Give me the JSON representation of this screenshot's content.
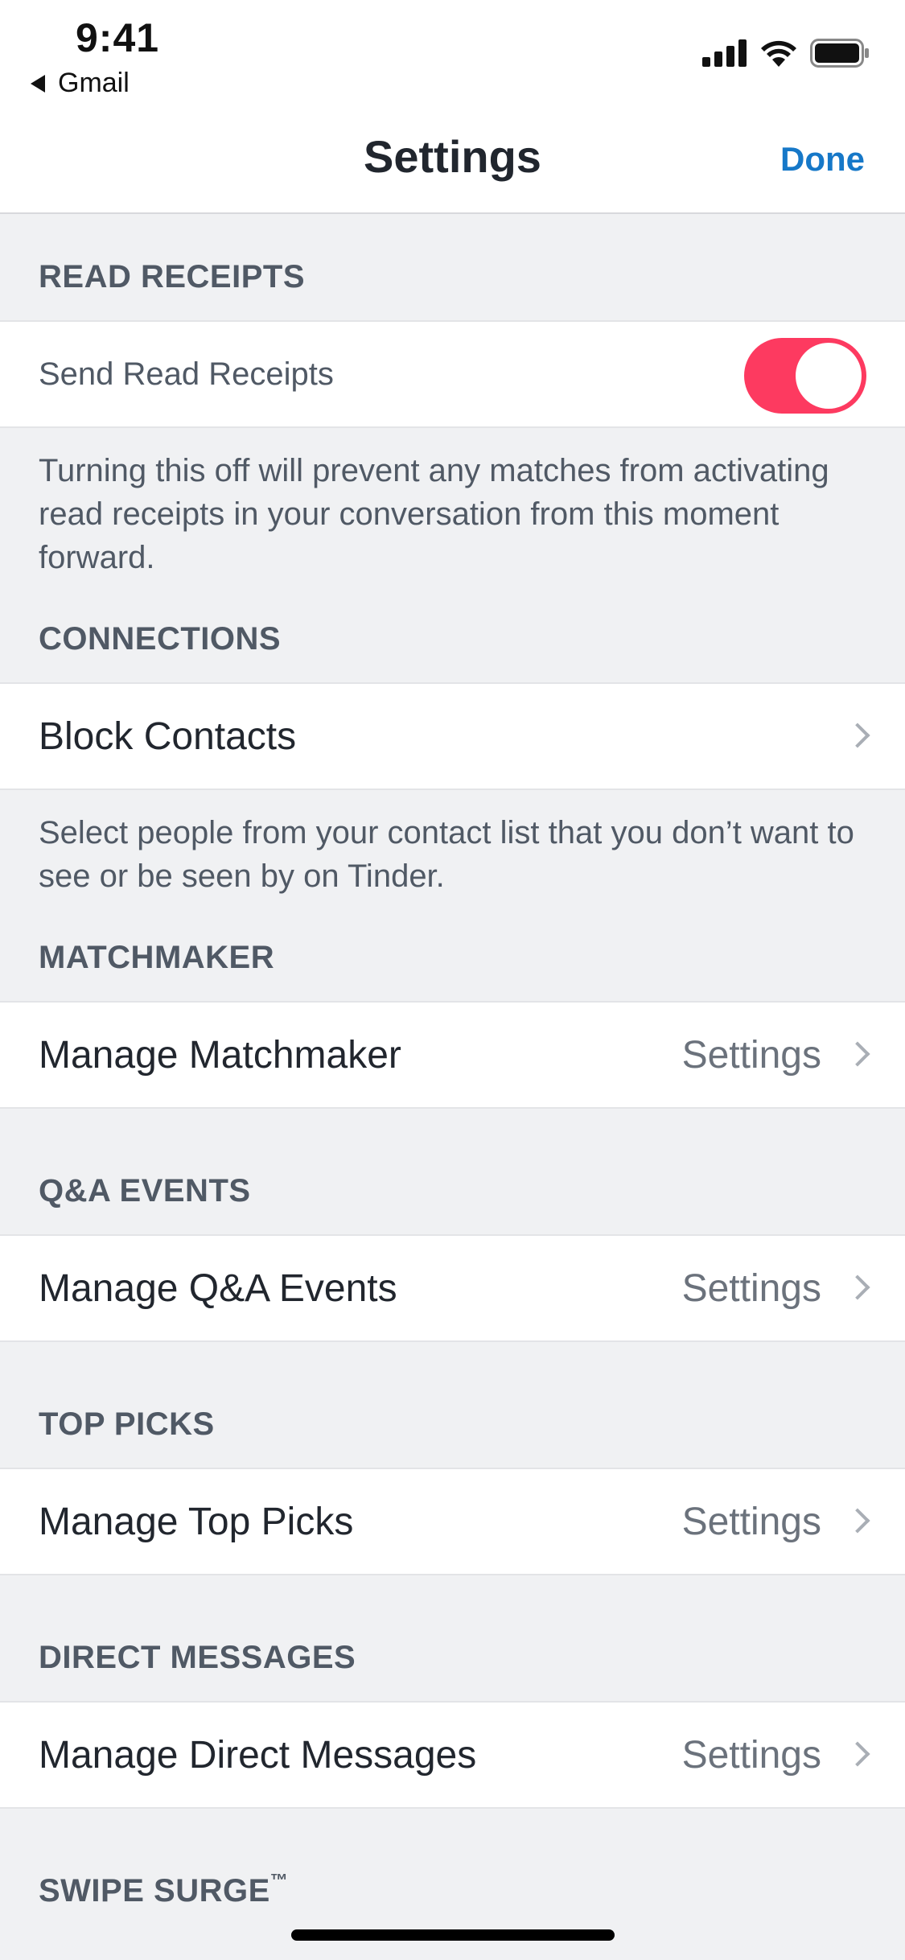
{
  "status_bar": {
    "time": "9:41",
    "back_app": "Gmail"
  },
  "nav": {
    "title": "Settings",
    "done_label": "Done"
  },
  "sections": {
    "read_receipts": {
      "header": "READ RECEIPTS",
      "row_label": "Send Read Receipts",
      "toggle_on": true,
      "description": "Turning this off will prevent any matches from activating read receipts in your conversation from this moment forward."
    },
    "connections": {
      "header": "CONNECTIONS",
      "row_label": "Block Contacts",
      "description": "Select people from your contact list that you don’t want to see or be seen by on Tinder."
    },
    "matchmaker": {
      "header": "MATCHMAKER",
      "row_label": "Manage Matchmaker",
      "row_value": "Settings"
    },
    "qa_events": {
      "header": "Q&A EVENTS",
      "row_label": "Manage Q&A Events",
      "row_value": "Settings"
    },
    "top_picks": {
      "header": "TOP PICKS",
      "row_label": "Manage Top Picks",
      "row_value": "Settings"
    },
    "direct_messages": {
      "header": "DIRECT MESSAGES",
      "row_label": "Manage Direct Messages",
      "row_value": "Settings"
    },
    "swipe_surge": {
      "header": "SWIPE SURGE",
      "trademark": "™"
    }
  },
  "colors": {
    "accent_blue": "#1678c8",
    "toggle_on": "#fd3a60",
    "background": "#f0f1f3"
  },
  "icons": [
    "signal-icon",
    "wifi-icon",
    "battery-icon",
    "back-triangle-icon",
    "chevron-right-icon"
  ]
}
